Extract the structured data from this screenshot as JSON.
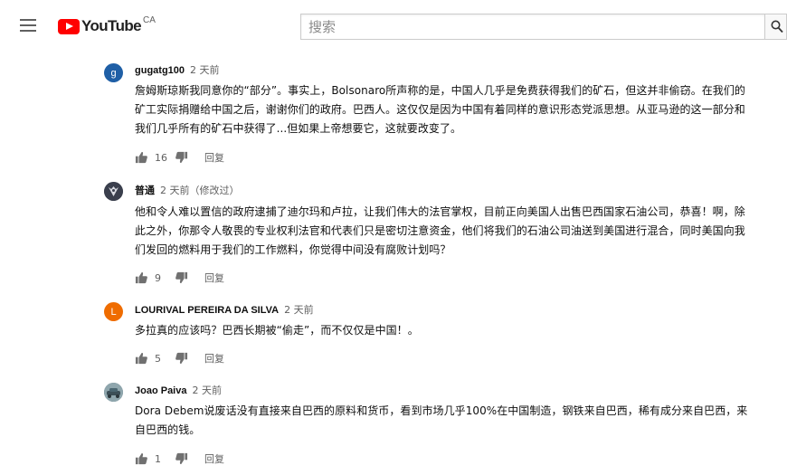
{
  "header": {
    "logo_text": "YouTube",
    "region": "CA",
    "search": {
      "placeholder": "搜索",
      "value": ""
    }
  },
  "comments": [
    {
      "author": "gugatg100",
      "time": "2 天前",
      "avatar_letter": "g",
      "avatar_color": "#1f5fa6",
      "text": "詹姆斯琼斯我同意你的“部分”。事实上，Bolsonaro所声称的是，中国人几乎是免费获得我们的矿石，但这并非偷窃。在我们的矿工实际捐赠给中国之后，谢谢你们的政府。巴西人。这仅仅是因为中国有着同样的意识形态党派思想。从亚马逊的这一部分和我们几乎所有的矿石中获得了...但如果上帝想要它，这就要改变了。",
      "likes": "16",
      "reply": "回复"
    },
    {
      "author": "普通",
      "time": "2 天前（修改过）",
      "avatar_letter": "",
      "avatar_color": "#3a3f4d",
      "text": "他和令人难以置信的政府逮捕了迪尔玛和卢拉，让我们伟大的法官掌权，目前正向美国人出售巴西国家石油公司，恭喜！啊，除此之外，你那令人敬畏的专业权利法官和代表们只是密切注意资金，他们将我们的石油公司油送到美国进行混合，同时美国向我们发回的燃料用于我们的工作燃料，你觉得中间没有腐败计划吗？",
      "likes": "9",
      "reply": "回复"
    },
    {
      "author": "LOURIVAL PEREIRA DA SILVA",
      "time": "2 天前",
      "avatar_letter": "L",
      "avatar_color": "#ef6c00",
      "text": "多拉真的应该吗？巴西长期被“偷走”，而不仅仅是中国！。",
      "likes": "5",
      "reply": "回复"
    },
    {
      "author": "Joao Paiva",
      "time": "2 天前",
      "avatar_letter": "",
      "avatar_color": "#5d7a86",
      "text": "Dora Debem说废话没有直接来自巴西的原料和货币，看到市场几乎100%在中国制造，钢铁来自巴西，稀有成分来自巴西，来自巴西的钱。",
      "likes": "1",
      "reply": "回复"
    }
  ]
}
